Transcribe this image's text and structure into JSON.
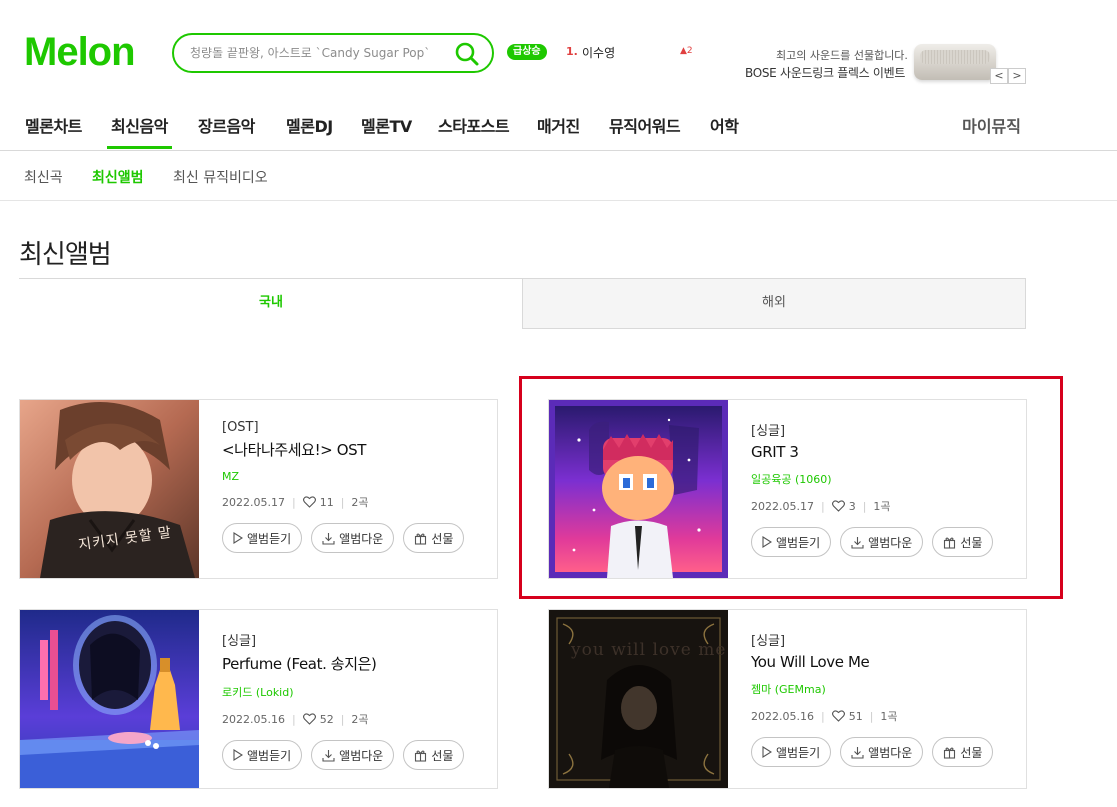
{
  "header": {
    "logo": "Melon",
    "search_placeholder": "청량돌 끝판왕, 아스트로 `Candy Sugar Pop`",
    "rise_badge": "급상승",
    "rank_number": "1.",
    "rank_name": "이수영",
    "rank_change": "2",
    "ad_line1": "최고의 사운드를 선물합니다.",
    "ad_line2": "BOSE 사운드링크 플렉스 이벤트",
    "ad_prev": "<",
    "ad_next": ">"
  },
  "gnb": {
    "items": [
      "멜론차트",
      "최신음악",
      "장르음악",
      "멜론DJ",
      "멜론TV",
      "스타포스트",
      "매거진",
      "뮤직어워드",
      "어학"
    ],
    "active_index": 1,
    "mymusic": "마이뮤직"
  },
  "subnav": {
    "items": [
      "최신곡",
      "최신앨범",
      "최신 뮤직비디오"
    ],
    "active_index": 1
  },
  "page_title": "최신앨범",
  "tabs": {
    "domestic": "국내",
    "overseas": "해외"
  },
  "buttons": {
    "listen": "앨범듣기",
    "download": "앨범다운",
    "gift": "선물"
  },
  "albums": [
    {
      "type": "[OST]",
      "title": "<나타나주세요!> OST",
      "artist": "MZ",
      "date": "2022.05.17",
      "likes": "11",
      "tracks": "2곡"
    },
    {
      "type": "[싱글]",
      "title": "GRIT 3",
      "artist": "일공육공 (1060)",
      "date": "2022.05.17",
      "likes": "3",
      "tracks": "1곡"
    },
    {
      "type": "[싱글]",
      "title": "Perfume (Feat. 송지은)",
      "artist": "로키드 (Lokid)",
      "date": "2022.05.16",
      "likes": "52",
      "tracks": "2곡"
    },
    {
      "type": "[싱글]",
      "title": "You Will Love Me",
      "artist": "젬마 (GEMma)",
      "date": "2022.05.16",
      "likes": "51",
      "tracks": "1곡"
    }
  ],
  "cover_texts": {
    "album0": "지키지 못할 말",
    "album3": "you will love me"
  },
  "colors": {
    "brand_green": "#1ec800",
    "highlight_red": "#d6001c"
  }
}
